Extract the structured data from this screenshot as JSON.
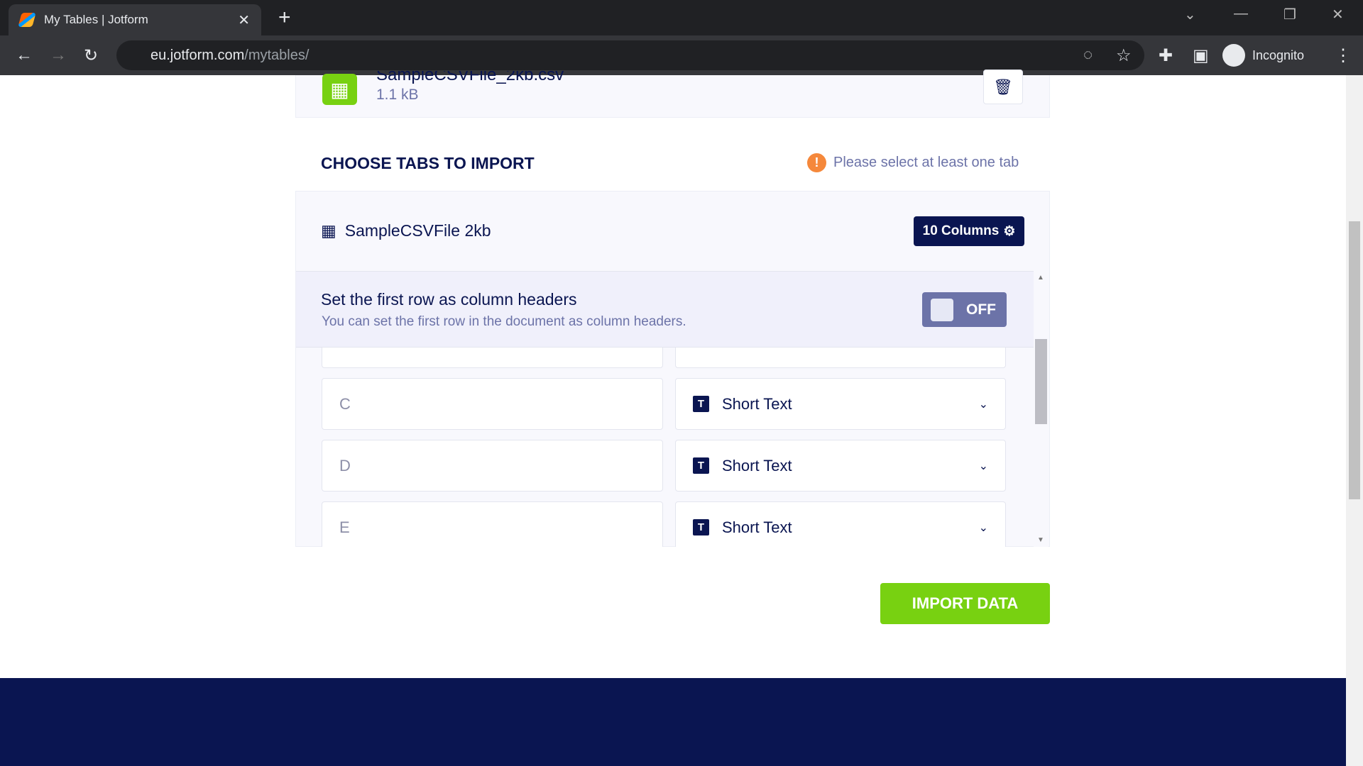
{
  "browser": {
    "tab_title": "My Tables | Jotform",
    "url_host": "eu.jotform.com",
    "url_path": "/mytables/",
    "profile": "Incognito"
  },
  "file": {
    "name": "SampleCSVFile_2kb.csv",
    "size": "1.1 kB"
  },
  "section": {
    "title": "CHOOSE TABS TO IMPORT",
    "warning": "Please select at least one tab"
  },
  "tab": {
    "name": "SampleCSVFile 2kb",
    "columns_button": "10 Columns"
  },
  "header_option": {
    "title": "Set the first row as column headers",
    "subtitle": "You can set the first row in the document as column headers.",
    "toggle": "OFF",
    "toggle_on": false
  },
  "columns": [
    {
      "name": "C",
      "type": "Short Text"
    },
    {
      "name": "D",
      "type": "Short Text"
    },
    {
      "name": "E",
      "type": "Short Text"
    }
  ],
  "import_button": "IMPORT DATA",
  "colors": {
    "navy": "#0a1551",
    "green": "#78d111",
    "warning": "#f5883b"
  }
}
